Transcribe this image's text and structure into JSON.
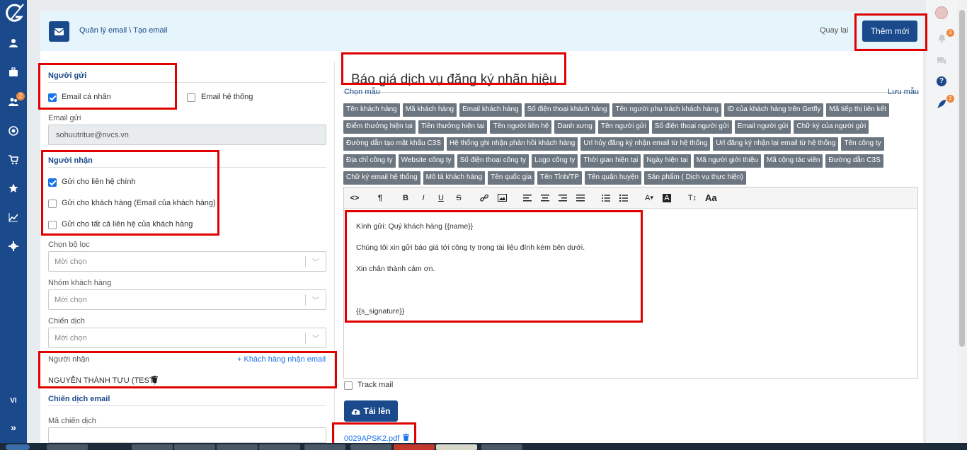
{
  "sidebar": {
    "lang_label": "VI",
    "cart_badge": "2"
  },
  "right_rail": {
    "notifications_badge": "3",
    "rocket_badge": "2"
  },
  "header": {
    "breadcrumb": "Quản lý email \\ Tạo email",
    "back_label": "Quay lại",
    "add_label": "Thêm mới"
  },
  "sender": {
    "title": "Người gửi",
    "personal_email_label": "Email cá nhân",
    "personal_email_checked": true,
    "system_email_label": "Email hệ thống",
    "system_email_checked": false,
    "sender_email_label": "Email gửi",
    "sender_email_value": "sohuutritue@nvcs.vn"
  },
  "recipient": {
    "title": "Người nhận",
    "options": [
      {
        "label": "Gửi cho liên hệ chính",
        "checked": true
      },
      {
        "label": "Gửi cho khách hàng (Email của khách hàng)",
        "checked": false
      },
      {
        "label": "Gửi cho tất cả liên hệ của khách hàng",
        "checked": false
      }
    ]
  },
  "filters": {
    "filter_label": "Chọn bộ lọc",
    "filter_placeholder": "Mời chọn",
    "group_label": "Nhóm khách hàng",
    "group_placeholder": "Mời chọn",
    "campaign_label": "Chiến dịch",
    "campaign_placeholder": "Mời chọn"
  },
  "recipients_list": {
    "label": "Người nhận",
    "add_link": "+ Khách hàng nhận email",
    "entries": [
      "NGUYỄN THÀNH TỰU (TEST)"
    ]
  },
  "email_campaign": {
    "title": "Chiến dịch email",
    "code_label": "Mã chiến dịch"
  },
  "compose": {
    "subject": "Báo giá dịch vụ đăng ký nhãn hiệu",
    "choose_template": "Chọn mẫu",
    "save_template": "Lưu mẫu",
    "tags": [
      "Tên khách hàng",
      "Mã khách hàng",
      "Email khách hàng",
      "Số điện thoại khách hàng",
      "Tên người phụ trách khách hàng",
      "ID của khách hàng trên Getfly",
      "Mã tiếp thị liên kết",
      "Điểm thưởng hiện tại",
      "Tiền thưởng hiện tại",
      "Tên người liên hệ",
      "Danh xưng",
      "Tên người gửi",
      "Số điện thoại người gửi",
      "Email người gửi",
      "Chữ ký của người gửi",
      "Đường dẫn tạo mật khẩu C3S",
      "Hệ thống ghi nhận phản hồi khách hàng",
      "Url hủy đăng ký nhận email từ hệ thống",
      "Url đăng ký nhận lại email từ hệ thống",
      "Tên công ty",
      "Địa chỉ công ty",
      "Website công ty",
      "Số điện thoại công ty",
      "Logo công ty",
      "Thời gian hiện tại",
      "Ngày hiện tại",
      "Mã người giới thiệu",
      "Mã cộng tác viên",
      "Đường dẫn C3S",
      "Chữ ký email hệ thống",
      "Mô tả khách hàng",
      "Tên quốc gia",
      "Tên Tỉnh/TP",
      "Tên quận huyện",
      "Sản phẩm ( Dịch vụ thực hiện)"
    ],
    "body": [
      "Kính gửi: Quý khách hàng {{name}}",
      "Chúng tôi xin gửi báo giá tới công ty trong tài liệu đính kèm bên dưới.",
      "Xin chân thành cảm ơn.",
      "",
      "{{s_signature}}"
    ],
    "track_mail_label": "Track mail",
    "track_mail_checked": false,
    "upload_label": "Tải lên",
    "attachment": "0029APSK2.pdf"
  },
  "colors": {
    "primary": "#1a4a8c",
    "highlight_border": "#e00000",
    "chip_bg": "#6c7680",
    "badge": "#f0883e"
  }
}
